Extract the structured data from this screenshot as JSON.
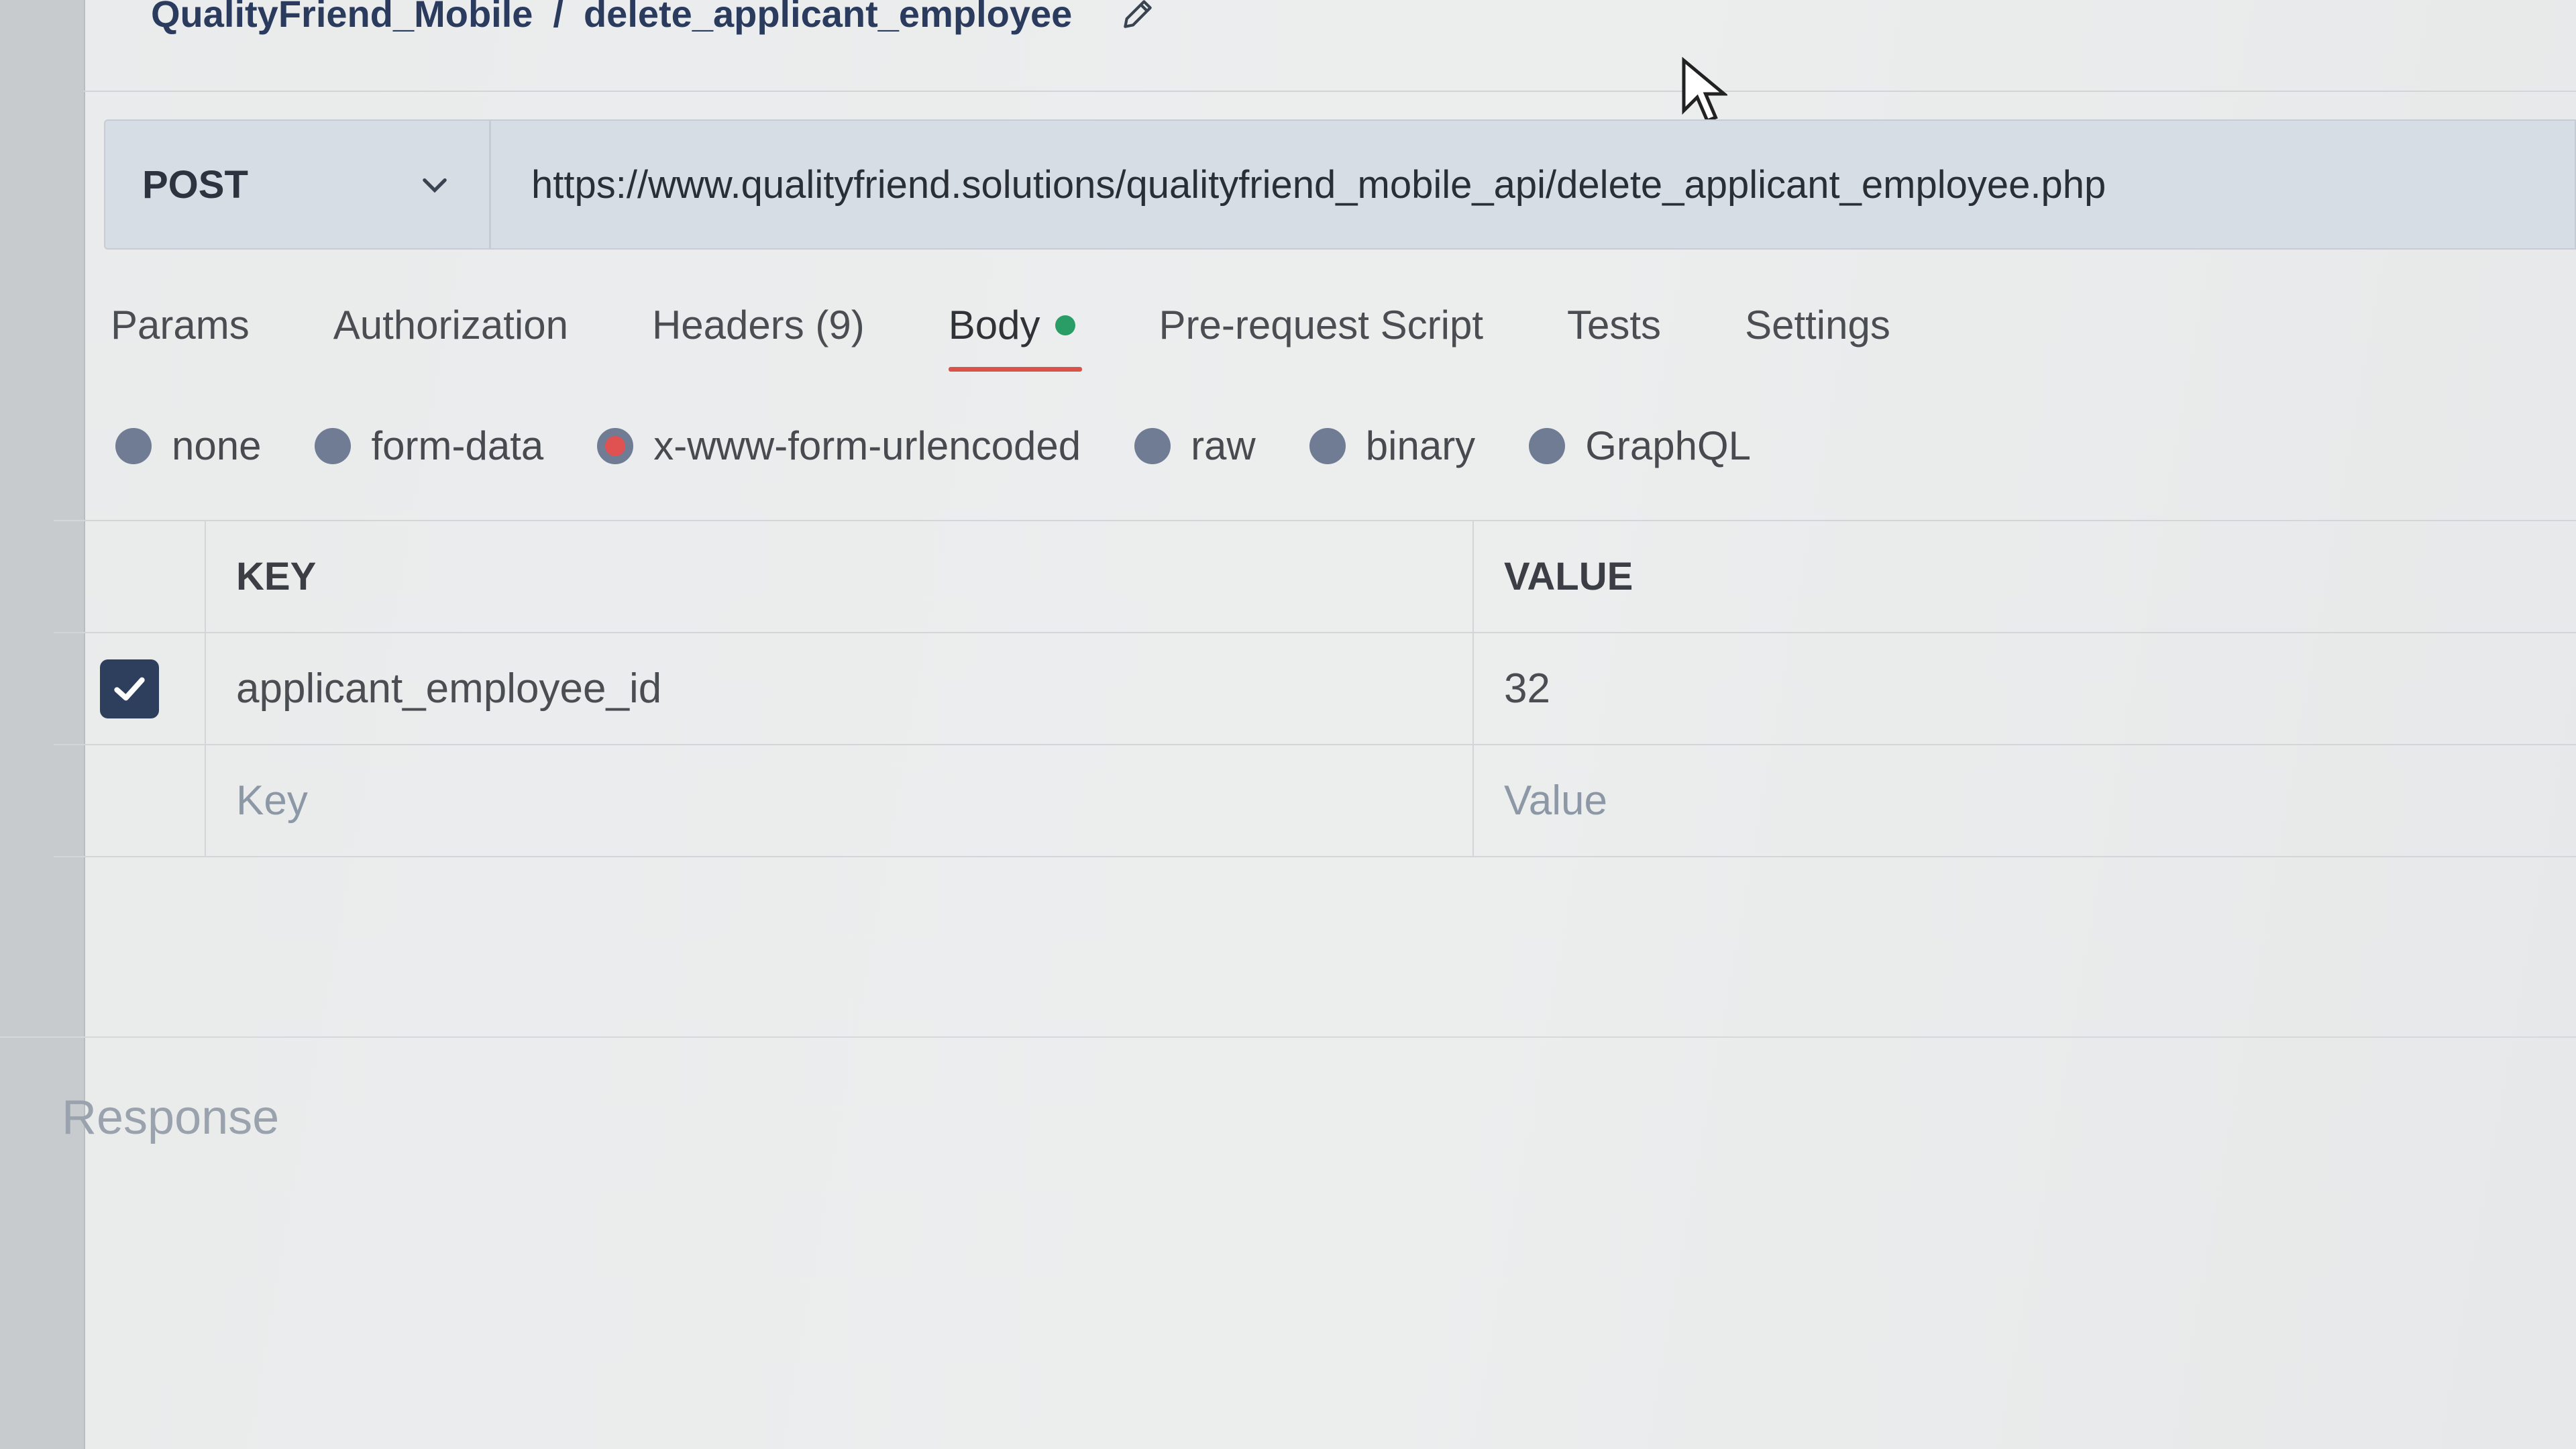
{
  "breadcrumb": {
    "collection": "QualityFriend_Mobile",
    "separator": "/",
    "request_name": "delete_applicant_employee",
    "edit_icon": "pencil-icon"
  },
  "request": {
    "method": "POST",
    "method_icon": "chevron-down-icon",
    "url": "https://www.qualityfriend.solutions/qualityfriend_mobile_api/delete_applicant_employee.php"
  },
  "tabs": [
    {
      "label": "Params"
    },
    {
      "label": "Authorization"
    },
    {
      "label": "Headers (9)"
    },
    {
      "label": "Body",
      "active": true
    },
    {
      "label": "Pre-request Script"
    },
    {
      "label": "Tests"
    },
    {
      "label": "Settings"
    }
  ],
  "body_types": [
    {
      "label": "none"
    },
    {
      "label": "form-data"
    },
    {
      "label": "x-www-form-urlencoded",
      "selected": true
    },
    {
      "label": "raw"
    },
    {
      "label": "binary"
    },
    {
      "label": "GraphQL"
    }
  ],
  "params_table": {
    "headers": {
      "key": "KEY",
      "value": "VALUE"
    },
    "rows": [
      {
        "checked": true,
        "key": "applicant_employee_id",
        "value": "32"
      }
    ],
    "new_row": {
      "key_placeholder": "Key",
      "value_placeholder": "Value"
    }
  },
  "response": {
    "label": "Response"
  },
  "colors": {
    "accent_underline": "#d9534a",
    "body_dot": "#2a9d66",
    "radio": "#6f7c93",
    "checkbox": "#2e3f5e"
  }
}
